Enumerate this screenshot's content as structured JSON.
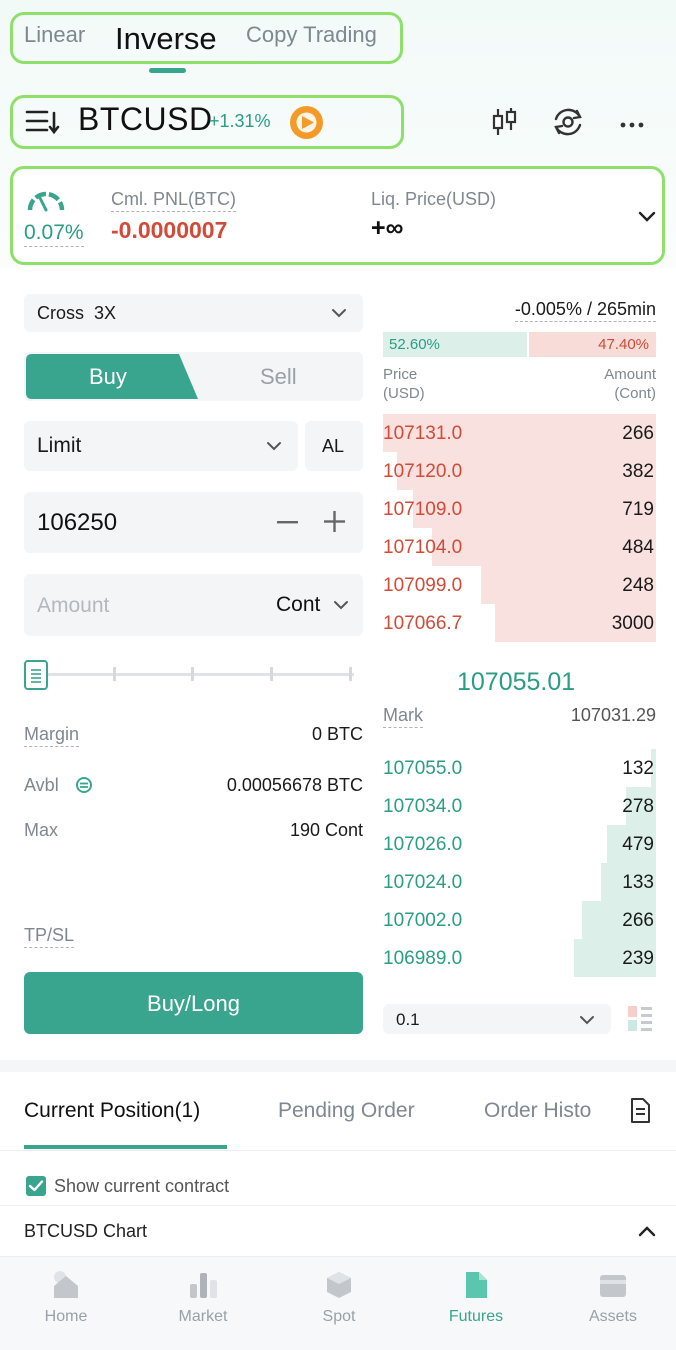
{
  "tabs": [
    {
      "label": "Linear"
    },
    {
      "label": "Inverse"
    },
    {
      "label": "Copy Trading"
    }
  ],
  "symbol": {
    "name": "BTCUSD",
    "change": "+1.31%"
  },
  "summary": {
    "ratio": "0.07%",
    "pnl_label": "Cml. PNL(BTC)",
    "pnl_value": "-0.0000007",
    "liq_label": "Liq. Price(USD)",
    "liq_value": "+∞"
  },
  "order_form": {
    "margin_mode": "Cross  3X",
    "buy_label": "Buy",
    "sell_label": "Sell",
    "order_type": "Limit",
    "al_label": "AL",
    "price": "106250",
    "amount_placeholder": "Amount",
    "amount_unit": "Cont",
    "margin_label": "Margin",
    "margin_value": "0 BTC",
    "avbl_label": "Avbl",
    "avbl_value": "0.00056678 BTC",
    "max_label": "Max",
    "max_value": "190 Cont",
    "tpsl_label": "TP/SL",
    "submit_label": "Buy/Long",
    "slider_fraction": 0
  },
  "orderbook": {
    "funding": "-0.005% / 265min",
    "buy_ratio": "52.60%",
    "sell_ratio": "47.40%",
    "buy_fraction": 0.526,
    "price_header": "Price\n(USD)",
    "amount_header": "Amount\n(Cont)",
    "asks": [
      {
        "price": "107131.0",
        "amount": "266",
        "depth": 1.0
      },
      {
        "price": "107120.0",
        "amount": "382",
        "depth": 0.95
      },
      {
        "price": "107109.0",
        "amount": "719",
        "depth": 0.89
      },
      {
        "price": "107104.0",
        "amount": "484",
        "depth": 0.82
      },
      {
        "price": "107099.0",
        "amount": "248",
        "depth": 0.64
      },
      {
        "price": "107066.7",
        "amount": "3000",
        "depth": 0.59
      }
    ],
    "last_price": "107055.01",
    "mark_label": "Mark",
    "mark_price": "107031.29",
    "bids": [
      {
        "price": "107055.0",
        "amount": "132",
        "depth": 0.02
      },
      {
        "price": "107034.0",
        "amount": "278",
        "depth": 0.11
      },
      {
        "price": "107026.0",
        "amount": "479",
        "depth": 0.18
      },
      {
        "price": "107024.0",
        "amount": "133",
        "depth": 0.2
      },
      {
        "price": "107002.0",
        "amount": "266",
        "depth": 0.27
      },
      {
        "price": "106989.0",
        "amount": "239",
        "depth": 0.3
      }
    ],
    "precision": "0.1"
  },
  "positions": {
    "tabs": [
      {
        "label": "Current Position(1)"
      },
      {
        "label": "Pending Order"
      },
      {
        "label": "Order Histo"
      }
    ],
    "show_current_label": "Show current contract",
    "show_current_checked": true,
    "chart_label": "BTCUSD Chart"
  },
  "nav": [
    {
      "label": "Home",
      "icon": "home-icon"
    },
    {
      "label": "Market",
      "icon": "market-icon"
    },
    {
      "label": "Spot",
      "icon": "spot-icon"
    },
    {
      "label": "Futures",
      "icon": "futures-icon"
    },
    {
      "label": "Assets",
      "icon": "assets-icon"
    }
  ],
  "colors": {
    "accent": "#3aa58f",
    "up": "#2a9d85",
    "down": "#d24a38"
  }
}
